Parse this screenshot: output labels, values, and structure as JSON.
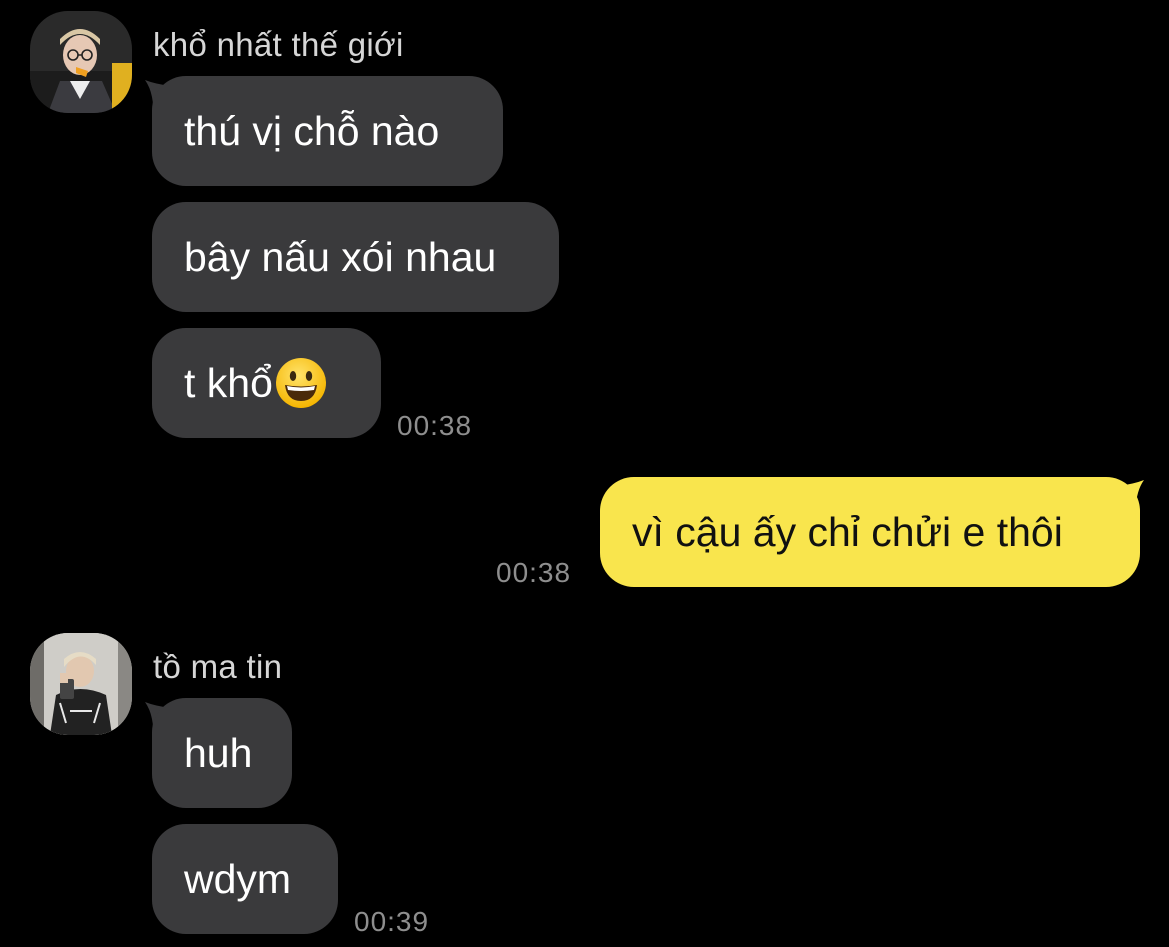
{
  "colors": {
    "background": "#000000",
    "incoming_bubble": "#3a3a3c",
    "outgoing_bubble": "#f9e54d",
    "timestamp": "#8e8e8e",
    "sender_name": "#d6d6d6"
  },
  "groups": [
    {
      "sender": "khổ nhất thế giới",
      "avatar_icon": "profile-photo-glasses",
      "messages": [
        "thú vị chỗ nào",
        "bây nấu xói nhau",
        "t khổ"
      ],
      "last_message_emoji": "grinning-face-emoji",
      "time": "00:38"
    },
    {
      "sender": "me",
      "messages": [
        "vì cậu ấy chỉ chửi e thôi"
      ],
      "time": "00:38"
    },
    {
      "sender": "tồ ma tin",
      "avatar_icon": "profile-photo-mirror-selfie",
      "messages": [
        "huh",
        "wdym"
      ],
      "time": "00:39"
    }
  ]
}
